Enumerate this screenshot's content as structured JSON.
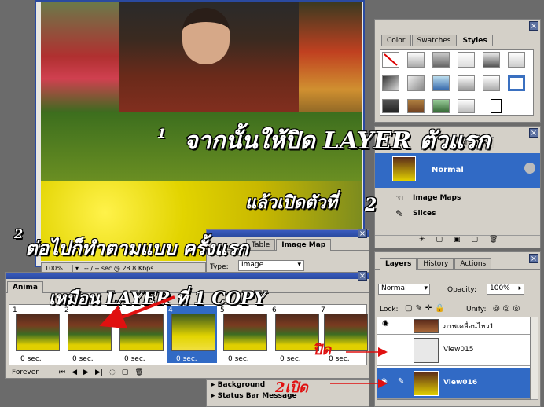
{
  "document": {
    "status_zoom": "100%",
    "status_info": "-- / -- sec @ 28.8 Kbps"
  },
  "styles_panel": {
    "tabs": [
      "Color",
      "Swatches",
      "Styles"
    ]
  },
  "optimize_panel": {
    "tabs": [
      "Color Table"
    ],
    "items": [
      {
        "label": "Normal"
      },
      {
        "label": "Image Maps"
      },
      {
        "label": "Slices"
      }
    ]
  },
  "imagemap_panel": {
    "tabs": [
      "Table",
      "Image Map"
    ],
    "type_label": "Type:",
    "type_value": "Image"
  },
  "animation_panel": {
    "tab": "Anima",
    "loop": "Forever",
    "frames": [
      {
        "num": "1",
        "delay": "0 sec."
      },
      {
        "num": "2",
        "delay": "0 sec."
      },
      {
        "num": "3",
        "delay": "0 sec."
      },
      {
        "num": "4",
        "delay": "0 sec."
      },
      {
        "num": "5",
        "delay": "0 sec."
      },
      {
        "num": "6",
        "delay": "0 sec."
      },
      {
        "num": "7",
        "delay": "0 sec."
      }
    ]
  },
  "web_content": {
    "items": [
      "Background",
      "Status Bar Message"
    ]
  },
  "layers_panel": {
    "tabs": [
      "Layers",
      "History",
      "Actions"
    ],
    "blend_mode": "Normal",
    "opacity_label": "Opacity:",
    "opacity_value": "100%",
    "lock_label": "Lock:",
    "unify_label": "Unify:",
    "layers": [
      {
        "name": "ภาพเคลื่อนไหว1"
      },
      {
        "name": "View015"
      },
      {
        "name": "View016"
      }
    ]
  },
  "annotations": {
    "step1_num": "1",
    "step1": "จากนั้นให้ปิด LAYER ตัวแรก",
    "step1b": "แล้วเปิดตัวที่",
    "step1b_num": "2",
    "step2_num": "2",
    "step2": "ต่อไปก็ทำตามแบบ ครั้งแรก",
    "step2b": "เหมือน LAYER ที่ 1 COPY",
    "close_label": "ปิด",
    "open_label": "2เปิด"
  },
  "colors": {
    "accent": "#316ac5",
    "panel": "#d4d0c8",
    "annotation": "#e01010"
  }
}
